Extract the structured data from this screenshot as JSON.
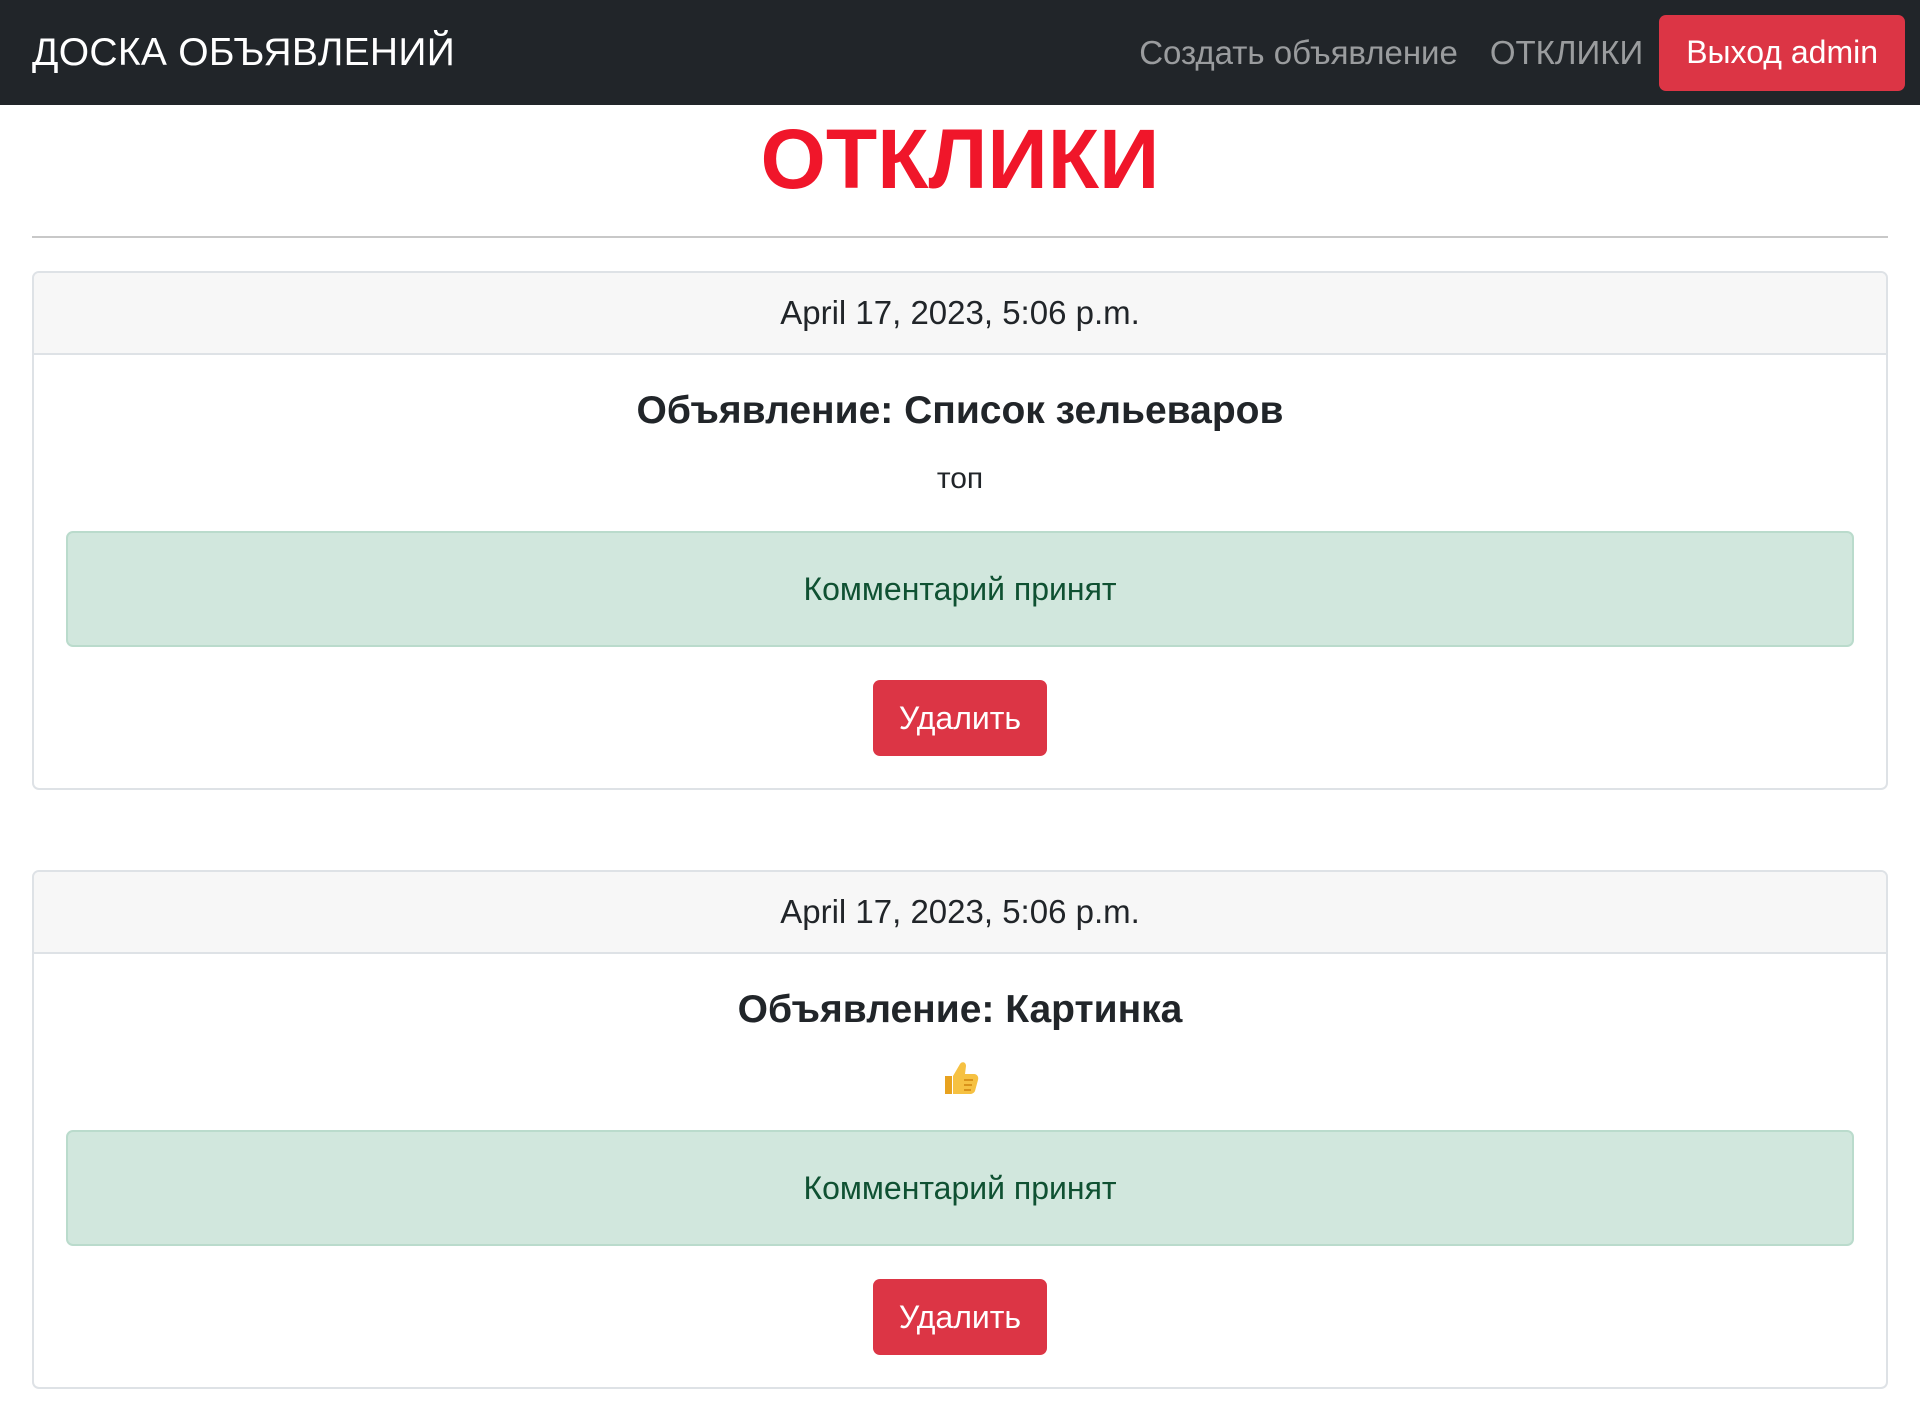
{
  "navbar": {
    "brand": "ДОСКА ОБЪЯВЛЕНИЙ",
    "links": [
      "Создать объявление",
      "ОТКЛИКИ"
    ],
    "logout_label": "Выход admin"
  },
  "page": {
    "title": "ОТКЛИКИ"
  },
  "responses": [
    {
      "date": "April 17, 2023, 5:06 p.m.",
      "title": "Объявление: Список зельеваров",
      "text": "топ",
      "status": "Комментарий принят",
      "delete_label": "Удалить"
    },
    {
      "date": "April 17, 2023, 5:06 p.m.",
      "title": "Объявление: Картинка",
      "text_icon": "thumbs-up-icon",
      "status": "Комментарий принят",
      "delete_label": "Удалить"
    }
  ],
  "colors": {
    "navbar_bg": "#212529",
    "danger": "#dc3545",
    "title_red": "#f0162a",
    "alert_bg": "#d1e7dd",
    "alert_text": "#0f5132"
  }
}
